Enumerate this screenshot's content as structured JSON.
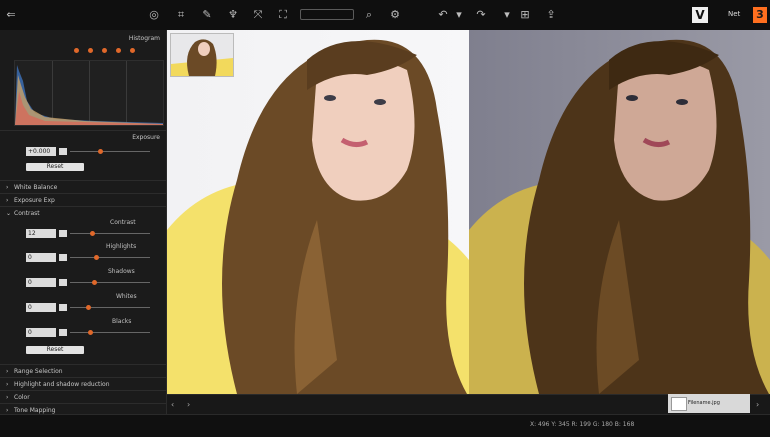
{
  "colors": {
    "accent": "#e0682a",
    "brand_orange": "#ff6f1f"
  },
  "topbar": {
    "icons": [
      "back-icon",
      "circle-icon",
      "crop-icon",
      "pen-icon",
      "brush-icon",
      "transform-icon",
      "frame-icon",
      "zoom-icon",
      "settings-icon",
      "undo-icon",
      "redo-icon",
      "grid-icon",
      "export-icon"
    ],
    "brand_letter": "V",
    "brand_name": "Net",
    "brand_number": "3"
  },
  "panel": {
    "histogram_title": "Histogram",
    "exposure": "Exposure",
    "exposure_value": "+0.000",
    "reset_label": "Reset",
    "white_balance": "White Balance",
    "exposure_sec": "Exposure Exp",
    "contrast": "Contrast",
    "contrast_value": "12",
    "highlights": "Highlights",
    "highlights_value": "0",
    "shadows": "Shadows",
    "shadows_value": "0",
    "whites": "Whites",
    "whites_value": "0",
    "blacks": "Blacks",
    "blacks_value": "0",
    "reset2_label": "Reset",
    "sections_bottom": [
      "Range Selection",
      "Highlight and shadow reduction",
      "Color",
      "Tone Mapping"
    ]
  },
  "status": {
    "coords": "X: 496  Y: 345  R: 199  G: 180  B: 168",
    "badge": "Filename.jpg"
  }
}
